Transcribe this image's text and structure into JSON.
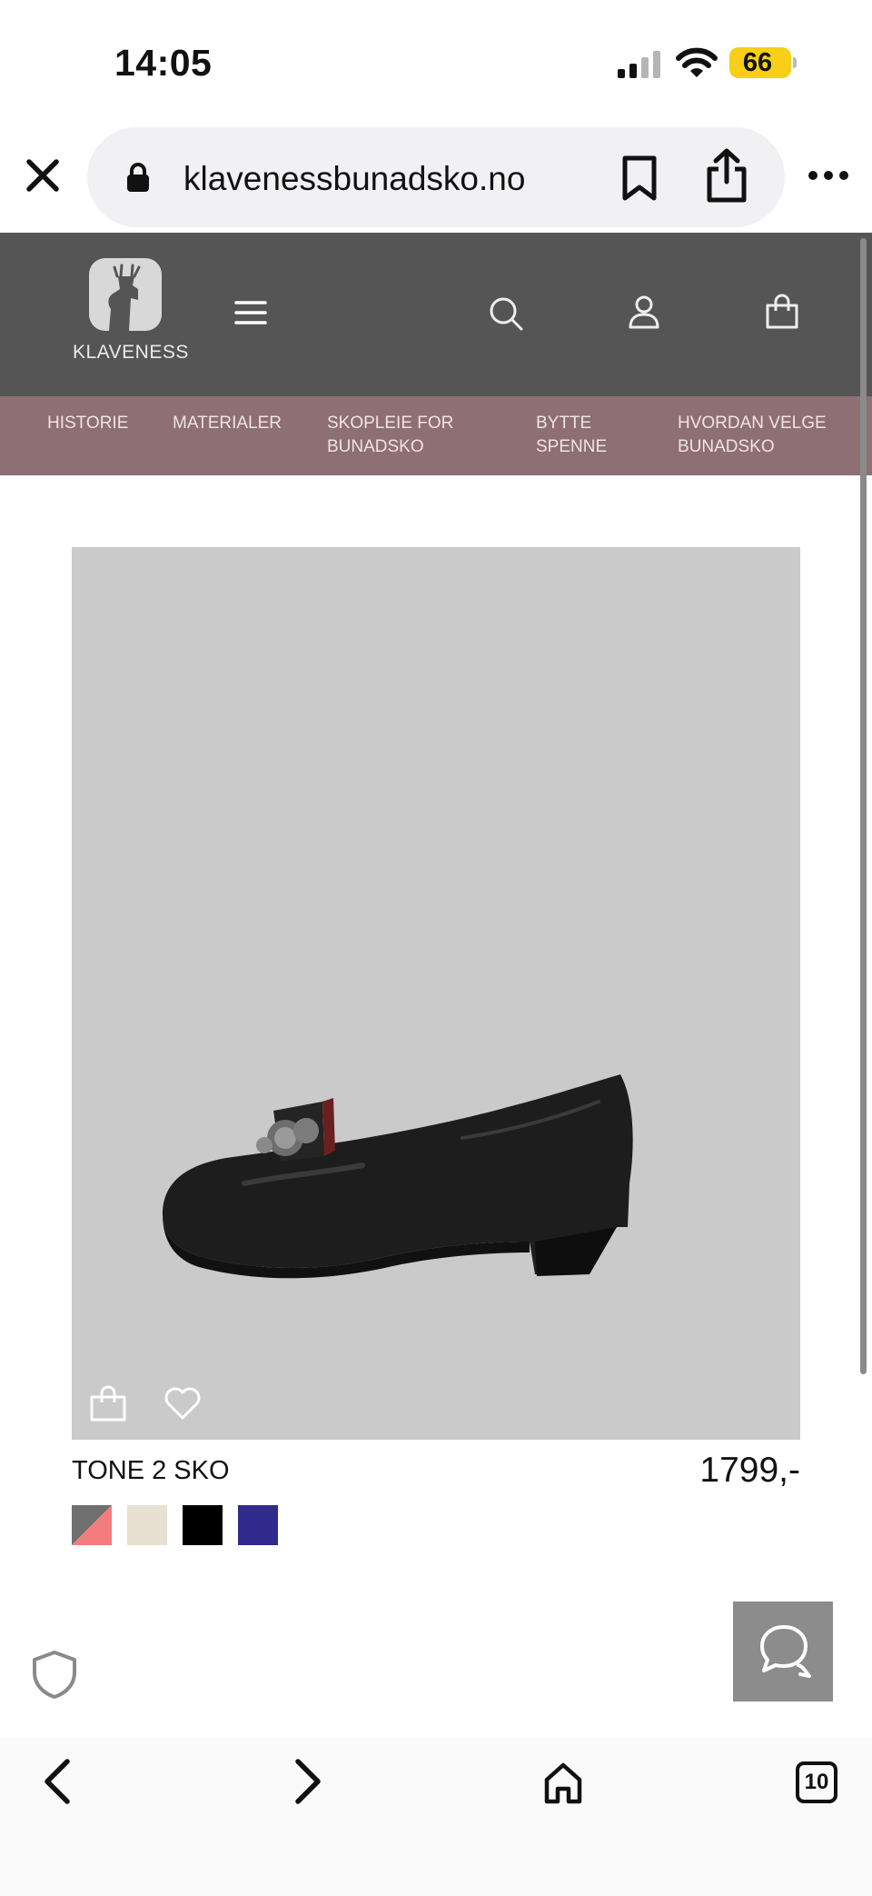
{
  "status_bar": {
    "time": "14:05",
    "battery": "66",
    "battery_color": "#f6cf16"
  },
  "browser": {
    "url": "klavenessbunadsko.no",
    "icons": [
      "close-icon",
      "lock-icon",
      "bookmark-icon",
      "share-icon",
      "more-icon"
    ]
  },
  "site": {
    "logo_text": "KLAVENESS",
    "header_color": "#555555",
    "icons": [
      "menu-icon",
      "search-icon",
      "account-icon",
      "cart-icon"
    ]
  },
  "sub_nav": {
    "color": "#8e6f74",
    "items": [
      {
        "label": "HISTORIE"
      },
      {
        "label": "MATERIALER"
      },
      {
        "label": "SKOPLEIE FOR BUNADSKO"
      },
      {
        "label": "BYTTE SPENNE"
      },
      {
        "label": "HVORDAN VELGE BUNADSKO"
      }
    ]
  },
  "product": {
    "name": "TONE 2 SKO",
    "price": "1799,-",
    "swatches": [
      {
        "name": "grey-pink",
        "colors": [
          "#6f6f6f",
          "#f47c7c"
        ]
      },
      {
        "name": "cream",
        "colors": [
          "#e8e1d2"
        ]
      },
      {
        "name": "black",
        "colors": [
          "#000000"
        ]
      },
      {
        "name": "navy-blue",
        "colors": [
          "#2f2a8c"
        ]
      }
    ]
  },
  "bottom_bar": {
    "tab_count": "10",
    "icons": [
      "back-icon",
      "forward-icon",
      "home-icon",
      "tabs-icon"
    ]
  }
}
